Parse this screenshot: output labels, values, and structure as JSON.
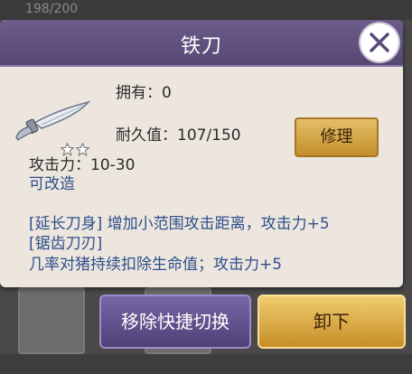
{
  "background": {
    "count_text": "198/200"
  },
  "dialog": {
    "title": "铁刀",
    "owned_label": "拥有：0",
    "durability_label": "耐久值：107/150",
    "repair_button": "修理",
    "stars_rating": 2,
    "attack_label": "攻击力：10-30",
    "modifiable_label": "可改造",
    "effects": [
      "[延长刀身] 增加小范围攻击距离，攻击力+5",
      "[锯齿刀刃]",
      "几率对猪持续扣除生命值；攻击力+5"
    ]
  },
  "actions": {
    "remove_shortcut": "移除快捷切换",
    "unequip": "卸下"
  },
  "colors": {
    "header": "#5f507e",
    "panel": "#ede6de",
    "gold_button": "#d9a640",
    "purple_button": "#6a5a99",
    "blue_text": "#2d4f8b"
  }
}
